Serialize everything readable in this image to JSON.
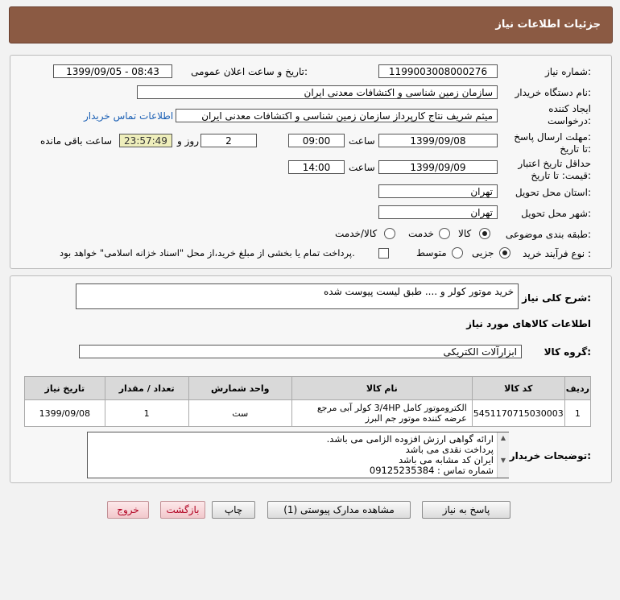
{
  "header": {
    "title": "جزئیات اطلاعات نیاز"
  },
  "info": {
    "need_number_label": "شماره نیاز:",
    "need_number": "1199003008000276",
    "announce_label": "تاریخ و ساعت اعلان عمومی:",
    "announce_value": "1399/09/05 - 08:43",
    "buyer_org_label": "نام دستگاه خریدار:",
    "buyer_org": "سازمان زمین شناسی و اکتشافات معدنی ایران",
    "creator_label_1": "ایجاد کننده",
    "creator_label_2": "درخواست:",
    "creator": "میثم شریف نتاج کارپرداز سازمان زمین شناسی و اکتشافات معدنی ایران",
    "contact_link": "اطلاعات تماس خریدار",
    "reply_label_1": "مهلت ارسال پاسخ:",
    "reply_label_2": "تا تاریخ:",
    "reply_date": "1399/09/08",
    "time_label": "ساعت",
    "reply_time": "09:00",
    "days": "2",
    "days_label": "روز و",
    "remaining": "23:57:49",
    "remaining_label": "ساعت باقی مانده",
    "validity_label_1": "حداقل تاریخ اعتبار",
    "validity_label_2": "قیمت: تا تاریخ:",
    "validity_date": "1399/09/09",
    "validity_time": "14:00",
    "province_label": "استان محل تحویل:",
    "province": "تهران",
    "city_label": "شهر محل تحویل:",
    "city": "تهران",
    "category_label": "طبقه بندی موضوعی:",
    "category_options": [
      "کالا",
      "خدمت",
      "کالا/خدمت"
    ],
    "process_label": "نوع فرآیند خرید :",
    "process_options": [
      "جزیی",
      "متوسط"
    ],
    "payment_note": "پرداخت تمام یا بخشی از مبلغ خرید،از محل \"اسناد خزانه اسلامی\" خواهد بود."
  },
  "summary": {
    "desc_label": "شرح کلی نیاز:",
    "desc": "خرید موتور کولر و .... طبق لیست پیوست شده",
    "goods_info_title": "اطلاعات کالاهای مورد نیاز",
    "group_label": "گروه کالا:",
    "group": "ابزارآلات الکتریکی",
    "table_headers": [
      "ردیف",
      "کد کالا",
      "نام کالا",
      "واحد شمارش",
      "تعداد / مقدار",
      "تاریخ نیاز"
    ],
    "rows": [
      {
        "row": "1",
        "code": "5451170715030003",
        "name": "الکتروموتور کامل 3/4HP کولر آبی مرجع عرضه کننده موتور جم البرز",
        "unit": "ست",
        "qty": "1",
        "date": "1399/09/08"
      }
    ],
    "notes_label": "توضیحات خریدار:",
    "notes": [
      "ارائه گواهی ارزش افزوده الزامی می باشد.",
      "پرداخت نقدی می باشد",
      "ایران کد مشابه می باشد",
      "شماره تماس : 09125235384"
    ]
  },
  "buttons": {
    "reply": "پاسخ به نیاز",
    "view_docs": "مشاهده مدارک پیوستی (1)",
    "print": "چاپ",
    "back": "بازگشت",
    "exit": "خروج"
  },
  "colors": {
    "header_bg": "#8b5a43",
    "link": "#1a5fb4",
    "timer_bg": "#eeeebb"
  }
}
